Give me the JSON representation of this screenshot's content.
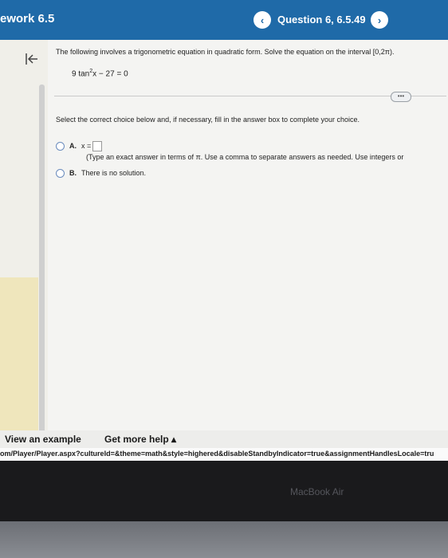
{
  "header": {
    "title": "ework 6.5",
    "question_label": "Question 6, 6.5.49",
    "prev_symbol": "‹",
    "next_symbol": "›"
  },
  "problem": {
    "statement": "The following involves a trigonometric equation in quadratic form. Solve the equation on the interval [0,2π).",
    "equation_prefix": "9 tan",
    "equation_exponent": "2",
    "equation_suffix": "x − 27 = 0",
    "more_label": "•••"
  },
  "instruction": "Select the correct choice below and, if necessary, fill in the answer box to complete your choice.",
  "choices": [
    {
      "letter": "A.",
      "text": "x =",
      "hint": "(Type an exact answer in terms of π. Use a comma to separate answers as needed. Use integers or"
    },
    {
      "letter": "B.",
      "text": "There is no solution."
    }
  ],
  "bottom": {
    "view_example": "View an example",
    "get_help": "Get more help ▴"
  },
  "url": "om/Player/Player.aspx?cultureId=&theme=math&style=highered&disableStandbyIndicator=true&assignmentHandlesLocale=tru",
  "device_label": "MacBook Air",
  "colors": {
    "header_bg": "#1f6aa8",
    "content_bg": "#f4f4f2"
  }
}
